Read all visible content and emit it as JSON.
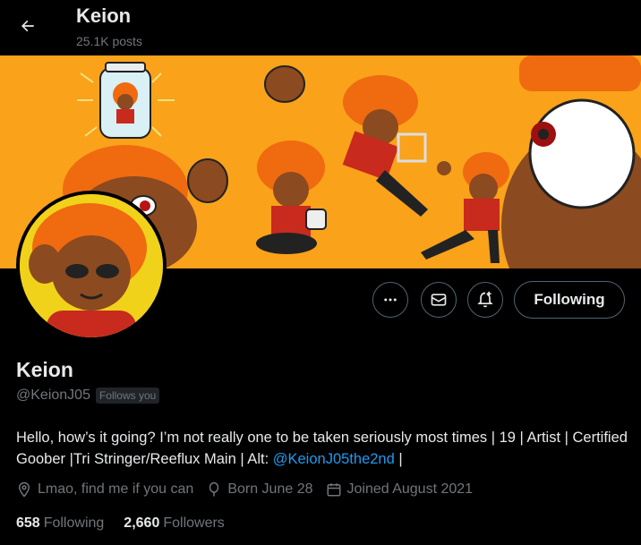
{
  "header": {
    "title": "Keion",
    "posts_count": "25.1K posts"
  },
  "profile": {
    "display_name": "Keion",
    "handle": "@KeionJ05",
    "follows_you_badge": "Follows you",
    "bio_text": "Hello, how’s it going? I’m not really one to be taken seriously most times | 19 | Artist | Certified Goober |Tri Stringer/Reeflux Main | Alt: ",
    "bio_link": "@KeionJ05the2nd",
    "bio_suffix": " |",
    "location": "Lmao, find me if you can",
    "birthday": "Born June 28",
    "joined": "Joined August 2021"
  },
  "actions": {
    "more_icon": "more-dots-icon",
    "message_icon": "envelope-icon",
    "notify_icon": "bell-plus-icon",
    "follow_label": "Following"
  },
  "stats": {
    "following_count": "658",
    "following_label": "Following",
    "followers_count": "2,660",
    "followers_label": "Followers"
  },
  "colors": {
    "background": "#000000",
    "text_primary": "#e7e9ea",
    "text_secondary": "#71767b",
    "link": "#1d9bf0",
    "banner_orange": "#f9a21a",
    "avatar_yellow": "#f1d21a"
  }
}
